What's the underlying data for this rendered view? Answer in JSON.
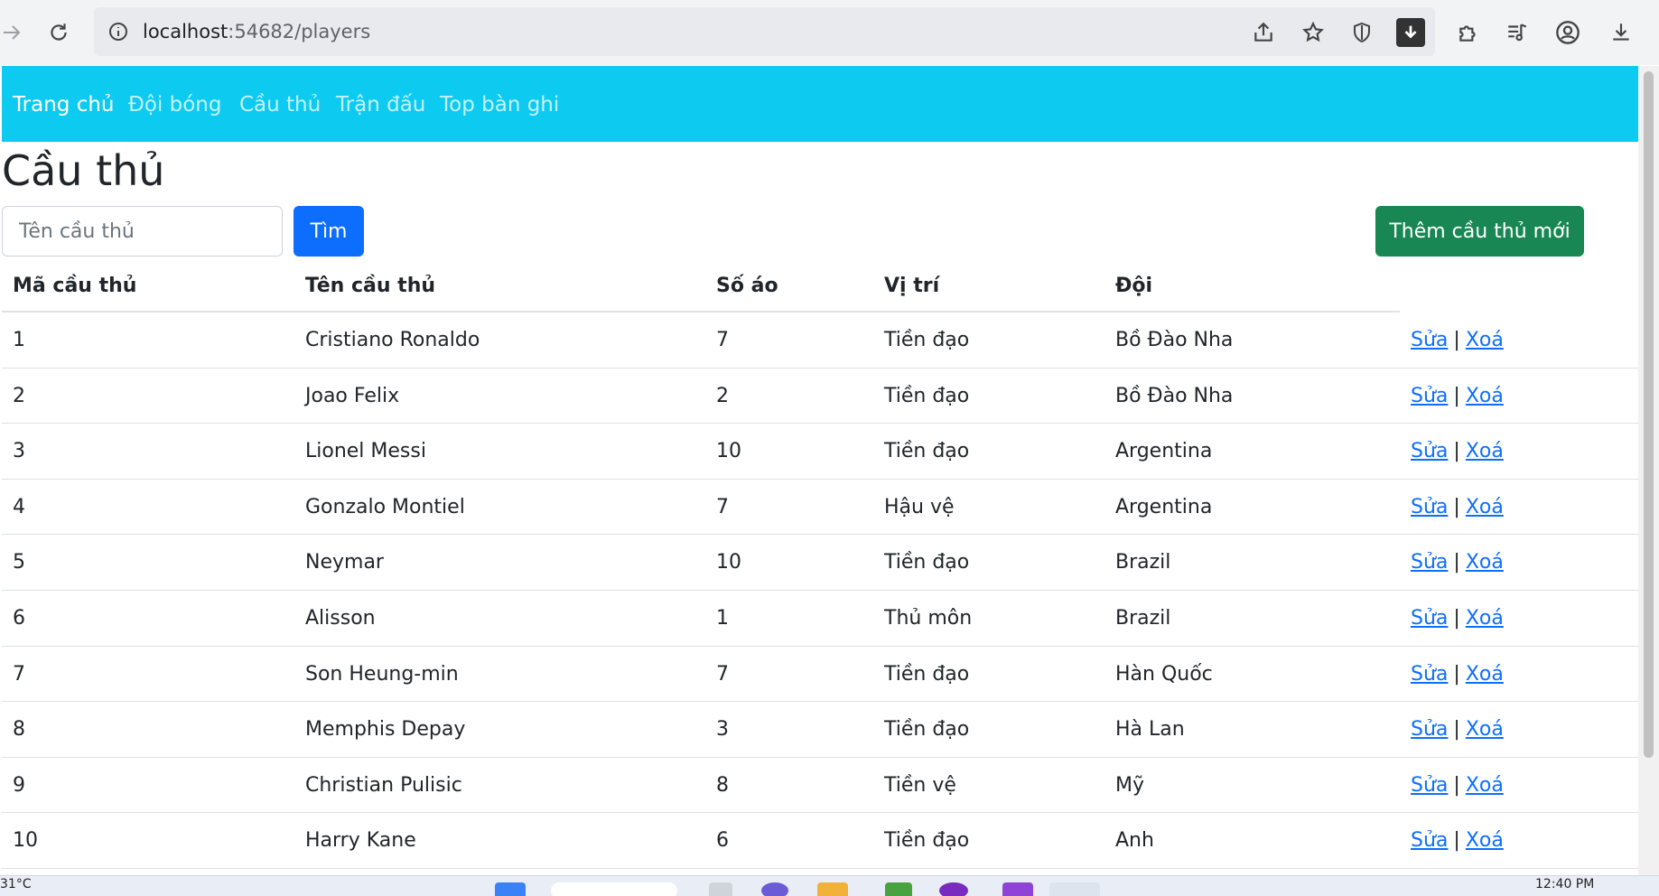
{
  "browser": {
    "url_host": "localhost",
    "url_rest": ":54682/players"
  },
  "navbar": {
    "items": [
      {
        "label": "Trang chủ",
        "active": true
      },
      {
        "label": "Đội bóng",
        "active": false
      },
      {
        "label": "Cầu thủ",
        "active": false
      },
      {
        "label": "Trận đấu",
        "active": false
      },
      {
        "label": "Top bàn ghi",
        "active": false
      }
    ]
  },
  "page": {
    "title": "Cầu thủ",
    "search_placeholder": "Tên cầu thủ",
    "search_button": "Tìm",
    "add_button": "Thêm cầu thủ mới"
  },
  "table": {
    "headers": [
      "Mã cầu thủ",
      "Tên cầu thủ",
      "Số áo",
      "Vị trí",
      "Đội"
    ],
    "edit_label": "Sửa",
    "separator": "|",
    "delete_label": "Xoá",
    "rows": [
      [
        "1",
        "Cristiano Ronaldo",
        "7",
        "Tiền đạo",
        "Bồ Đào Nha"
      ],
      [
        "2",
        "Joao Felix",
        "2",
        "Tiền đạo",
        "Bồ Đào Nha"
      ],
      [
        "3",
        "Lionel Messi",
        "10",
        "Tiền đạo",
        "Argentina"
      ],
      [
        "4",
        "Gonzalo Montiel",
        "7",
        "Hậu vệ",
        "Argentina"
      ],
      [
        "5",
        "Neymar",
        "10",
        "Tiền đạo",
        "Brazil"
      ],
      [
        "6",
        "Alisson",
        "1",
        "Thủ môn",
        "Brazil"
      ],
      [
        "7",
        "Son Heung-min",
        "7",
        "Tiền đạo",
        "Hàn Quốc"
      ],
      [
        "8",
        "Memphis Depay",
        "3",
        "Tiền đạo",
        "Hà Lan"
      ],
      [
        "9",
        "Christian Pulisic",
        "8",
        "Tiền vệ",
        "Mỹ"
      ],
      [
        "10",
        "Harry Kane",
        "6",
        "Tiền đạo",
        "Anh"
      ]
    ]
  },
  "taskbar": {
    "weather": "31°C",
    "clock": "12:40 PM"
  },
  "colors": {
    "navbar": "#0dcaf0",
    "primary": "#0d6efd",
    "success": "#198754",
    "link": "#0d6efd"
  }
}
